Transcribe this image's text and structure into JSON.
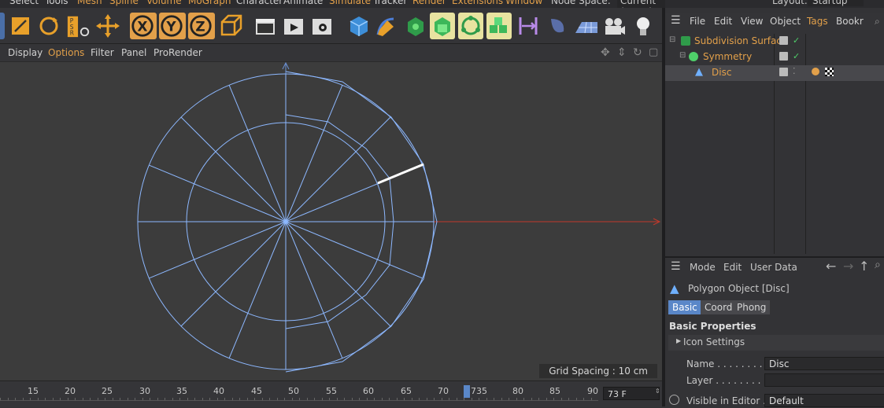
{
  "menubar": {
    "items": [
      "Select",
      "Tools",
      "Mesh",
      "Spline",
      "Volume",
      "MoGraph",
      "Character",
      "Animate",
      "Simulate",
      "Tracker",
      "Render",
      "Extensions",
      "Window"
    ],
    "node_space_label": "Node Space:",
    "node_space_value": "Current (Standard/Physical)",
    "layout_label": "Layout:",
    "layout_value": "Startup"
  },
  "viewport_menu": {
    "items": [
      "Display",
      "Options",
      "Filter",
      "Panel",
      "ProRender"
    ],
    "grid_spacing": "Grid Spacing : 10 cm"
  },
  "timeline": {
    "ticks": [
      "15",
      "20",
      "25",
      "30",
      "35",
      "40",
      "45",
      "50",
      "55",
      "60",
      "65",
      "70",
      "735",
      "80",
      "85",
      "90"
    ],
    "current_frame": "73 F"
  },
  "object_manager": {
    "menu": [
      "File",
      "Edit",
      "View",
      "Object",
      "Tags",
      "Bookr"
    ],
    "objects": [
      {
        "name": "Subdivision Surface"
      },
      {
        "name": "Symmetry"
      },
      {
        "name": "Disc"
      }
    ]
  },
  "attribute_manager": {
    "menu": [
      "Mode",
      "Edit",
      "User Data"
    ],
    "object_title": "Polygon Object [Disc]",
    "tabs": [
      "Basic",
      "Coord.",
      "Phong"
    ],
    "section_title": "Basic Properties",
    "group": "Icon Settings",
    "fields": {
      "name_label": "Name . . . . . . . . .",
      "name_value": "Disc",
      "layer_label": "Layer . . . . . . . . .",
      "layer_value": "",
      "visible_label": "Visible in Editor . .",
      "visible_value": "Default"
    }
  },
  "colors": {
    "accent_orange": "#e2a04a",
    "wire_blue": "#8db8ff",
    "axis_red": "#c0392b",
    "active_tab": "#5a87c8"
  }
}
